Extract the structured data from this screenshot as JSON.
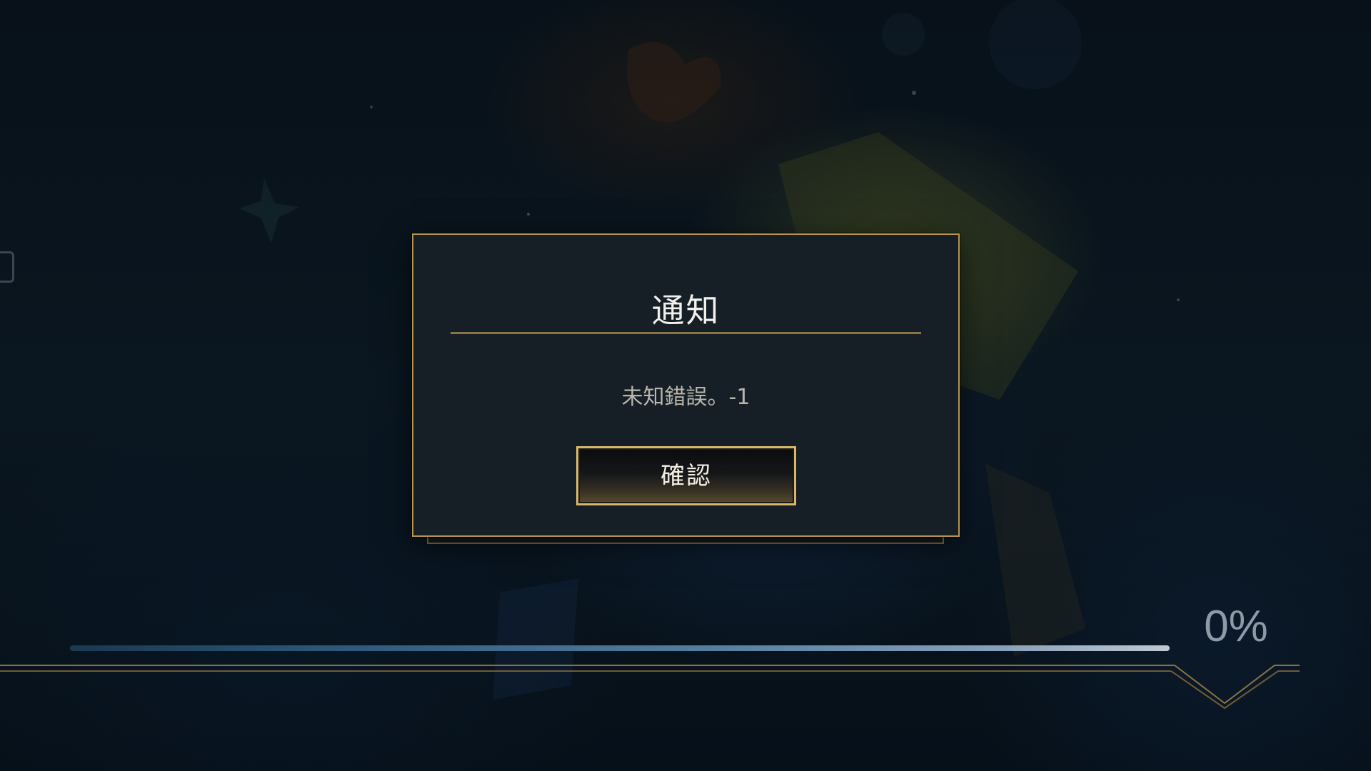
{
  "dialog": {
    "title": "通知",
    "message": "未知錯誤。-1",
    "confirm_label": "確認"
  },
  "loading": {
    "progress_fraction": 0.0,
    "percent_text": "0%"
  },
  "colors": {
    "gold_border": "#b8954a",
    "dialog_bg": "#161e26",
    "background": "#07111a"
  }
}
